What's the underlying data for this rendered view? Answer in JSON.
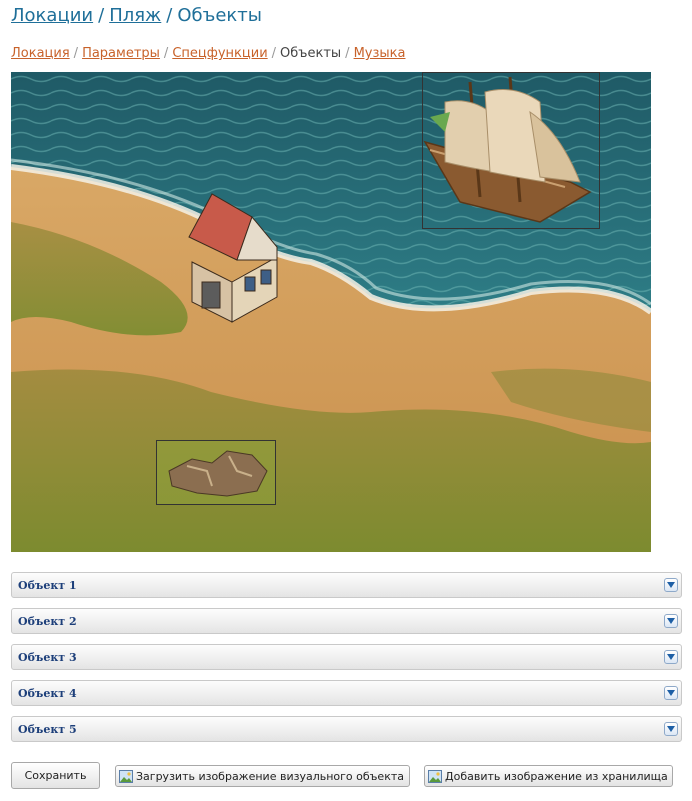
{
  "title": {
    "link_location": "Локации",
    "link_beach": "Пляж",
    "current": "Объекты",
    "separator": "/"
  },
  "breadcrumb": {
    "items": [
      "Локация",
      "Параметры",
      "Спецфункции"
    ],
    "current": "Объекты",
    "after": "Музыка",
    "separator": "/"
  },
  "scene": {
    "objects": [
      "ship",
      "house",
      "rock"
    ]
  },
  "accordion": {
    "items": [
      "Объект 1",
      "Объект 2",
      "Объект 3",
      "Объект 4",
      "Объект 5"
    ]
  },
  "buttons": {
    "save": "Сохранить",
    "upload": "Загрузить изображение визуального объекта",
    "add_from_storage": "Добавить изображение из хранилища"
  },
  "icons": {
    "chevron": "chevron-down-icon",
    "image": "image-icon"
  },
  "colors": {
    "title_link": "#1f6f99",
    "breadcrumb_link": "#c8622a",
    "accordion_label": "#1d3f7a"
  }
}
